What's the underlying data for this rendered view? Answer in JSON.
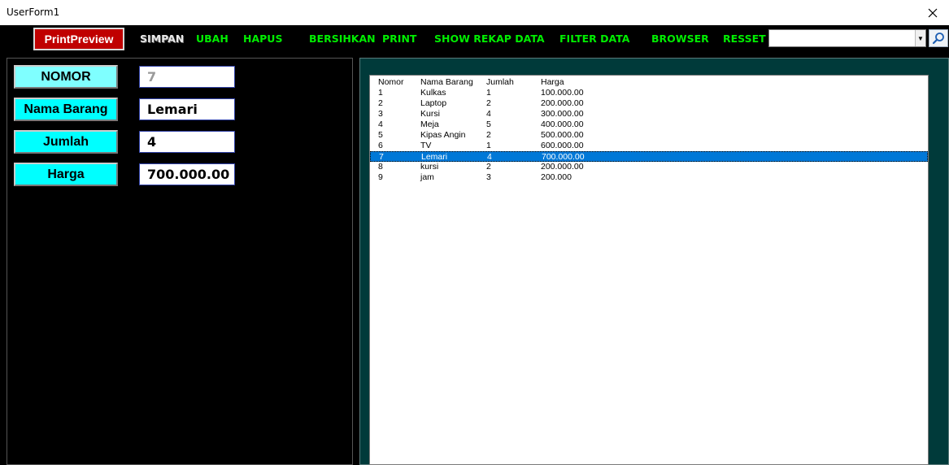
{
  "window": {
    "title": "UserForm1"
  },
  "toolbar": {
    "print_preview": "PrintPreview",
    "simpan": "SIMPAN",
    "ubah": "UBAH",
    "hapus": "HAPUS",
    "bersihkan": "BERSIHKAN",
    "print": "PRINT",
    "show_rekap": "SHOW REKAP DATA",
    "filter": "FILTER DATA",
    "browser": "BROWSER",
    "resset": "RESSET",
    "search_value": ""
  },
  "form": {
    "nomor_label": "NOMOR",
    "nomor_value": "7",
    "nama_label": "Nama Barang",
    "nama_value": "Lemari",
    "jumlah_label": "Jumlah",
    "jumlah_value": "4",
    "harga_label": "Harga",
    "harga_value": "700.000.00"
  },
  "list": {
    "headers": [
      "Nomor",
      "Nama Barang",
      "Jumlah",
      "Harga"
    ],
    "selected_index": 6,
    "rows": [
      [
        "1",
        "Kulkas",
        "1",
        "100.000.00"
      ],
      [
        "2",
        "Laptop",
        "2",
        "200.000.00"
      ],
      [
        "3",
        "Kursi",
        "4",
        "300.000.00"
      ],
      [
        "4",
        "Meja",
        "5",
        "400.000.00"
      ],
      [
        "5",
        "Kipas Angin",
        "2",
        "500.000.00"
      ],
      [
        "6",
        "TV",
        "1",
        "600.000.00"
      ],
      [
        "7",
        "Lemari",
        "4",
        "700.000.00"
      ],
      [
        "8",
        "kursi",
        "2",
        "200.000.00"
      ],
      [
        "9",
        "jam",
        "3",
        "200.000"
      ]
    ]
  },
  "colors": {
    "toolbar_text": "#00ee00",
    "label_bg": "#00ffff",
    "print_button": "#c00000",
    "selection": "#0078d7",
    "right_panel": "#003a3a"
  }
}
